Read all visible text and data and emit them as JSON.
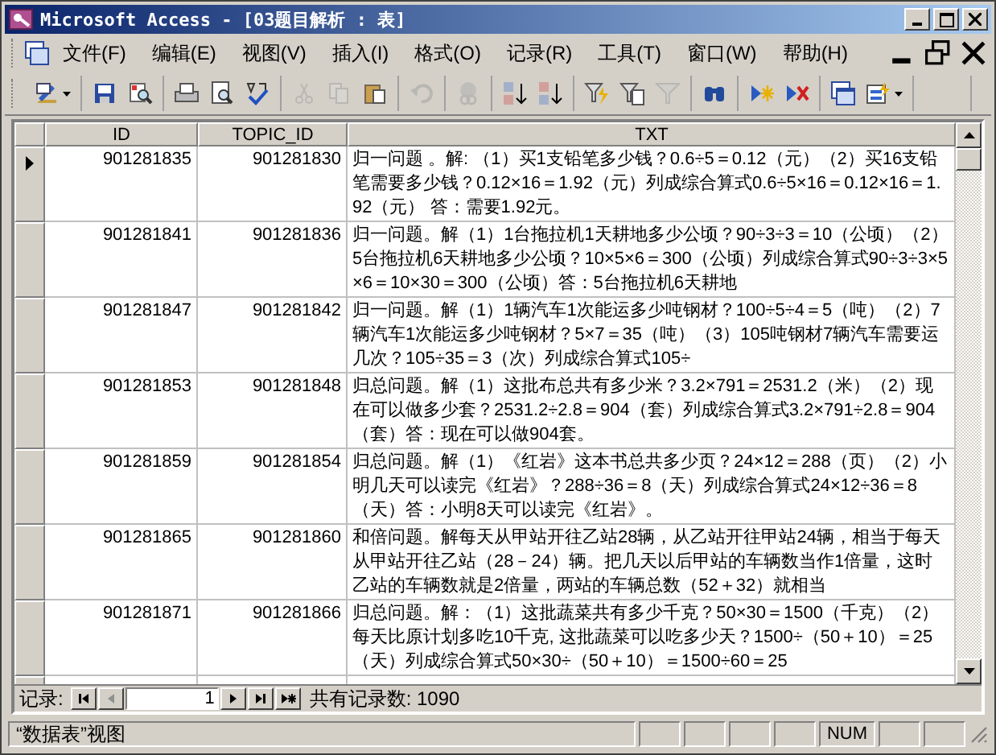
{
  "window": {
    "title": "Microsoft Access - [03题目解析 : 表]"
  },
  "menu": [
    "文件(F)",
    "编辑(E)",
    "视图(V)",
    "插入(I)",
    "格式(O)",
    "记录(R)",
    "工具(T)",
    "窗口(W)",
    "帮助(H)"
  ],
  "toolbar": [
    [
      {
        "kind": "design-view",
        "disabled": false
      }
    ],
    [
      {
        "kind": "save",
        "disabled": false
      },
      {
        "kind": "file-search",
        "disabled": false
      }
    ],
    [
      {
        "kind": "print",
        "disabled": false
      },
      {
        "kind": "print-preview",
        "disabled": false
      },
      {
        "kind": "spelling",
        "disabled": false
      }
    ],
    [
      {
        "kind": "cut",
        "disabled": true
      },
      {
        "kind": "copy",
        "disabled": true
      },
      {
        "kind": "paste",
        "disabled": false
      }
    ],
    [
      {
        "kind": "undo",
        "disabled": true
      }
    ],
    [
      {
        "kind": "hyperlink",
        "disabled": true
      }
    ],
    [
      {
        "kind": "sort-asc",
        "disabled": false
      },
      {
        "kind": "sort-desc",
        "disabled": false
      }
    ],
    [
      {
        "kind": "filter-selection",
        "disabled": false
      },
      {
        "kind": "filter-form",
        "disabled": false
      },
      {
        "kind": "apply-filter",
        "disabled": true
      }
    ],
    [
      {
        "kind": "find",
        "disabled": false
      }
    ],
    [
      {
        "kind": "new-record",
        "disabled": false
      },
      {
        "kind": "delete-record",
        "disabled": false
      }
    ],
    [
      {
        "kind": "database-window",
        "disabled": false
      },
      {
        "kind": "new-object",
        "disabled": false
      }
    ]
  ],
  "table": {
    "columns": [
      "ID",
      "TOPIC_ID",
      "TXT"
    ],
    "rows": [
      {
        "selected": true,
        "cells": [
          "901281835",
          "901281830",
          "归一问题 。解: （1）买1支铅笔多少钱？0.6÷5＝0.12（元）（2）买16支铅笔需要多少钱？0.12×16＝1.92（元）列成综合算式0.6÷5×16＝0.12×16＝1.92（元） 答：需要1.92元。"
        ]
      },
      {
        "selected": false,
        "cells": [
          "901281841",
          "901281836",
          "归一问题。解（1）1台拖拉机1天耕地多少公顷？90÷3÷3＝10（公顷）（2）5台拖拉机6天耕地多少公顷？10×5×6＝300（公顷）列成综合算式90÷3÷3×5×6＝10×30＝300（公顷）答：5台拖拉机6天耕地"
        ]
      },
      {
        "selected": false,
        "cells": [
          "901281847",
          "901281842",
          "归一问题。解（1）1辆汽车1次能运多少吨钢材？100÷5÷4＝5（吨）（2）7辆汽车1次能运多少吨钢材？5×7＝35（吨）（3）105吨钢材7辆汽车需要运几次？105÷35＝3（次）列成综合算式105÷"
        ]
      },
      {
        "selected": false,
        "cells": [
          "901281853",
          "901281848",
          "归总问题。解（1）这批布总共有多少米？3.2×791＝2531.2（米）（2）现在可以做多少套？2531.2÷2.8＝904（套）列成综合算式3.2×791÷2.8＝904（套）答：现在可以做904套。"
        ]
      },
      {
        "selected": false,
        "cells": [
          "901281859",
          "901281854",
          "归总问题。解（1）《红岩》这本书总共多少页？24×12＝288（页）（2）小明几天可以读完《红岩》？288÷36＝8（天）列成综合算式24×12÷36＝8（天）答：小明8天可以读完《红岩》。"
        ]
      },
      {
        "selected": false,
        "cells": [
          "901281865",
          "901281860",
          "和倍问题。解每天从甲站开往乙站28辆，从乙站开往甲站24辆，相当于每天从甲站开往乙站（28－24）辆。把几天以后甲站的车辆数当作1倍量，这时乙站的车辆数就是2倍量，两站的车辆总数（52＋32）就相当"
        ]
      },
      {
        "selected": false,
        "cells": [
          "901281871",
          "901281866",
          "归总问题。解：（1）这批蔬菜共有多少千克？50×30＝1500（千克）（2）每天比原计划多吃10千克, 这批蔬菜可以吃多少天？1500÷（50＋10）＝25（天）列成综合算式50×30÷（50＋10）＝1500÷60＝25"
        ]
      }
    ]
  },
  "record_nav": {
    "label": "记录:",
    "buttons": [
      {
        "kind": "first",
        "disabled": false
      },
      {
        "kind": "prev",
        "disabled": true
      },
      {
        "kind": "current",
        "value": "1"
      },
      {
        "kind": "next",
        "disabled": false
      },
      {
        "kind": "last",
        "disabled": false
      },
      {
        "kind": "new",
        "disabled": false
      }
    ],
    "total": "共有记录数: 1090"
  },
  "status_bar": {
    "view": "“数据表”视图",
    "num": "NUM"
  }
}
